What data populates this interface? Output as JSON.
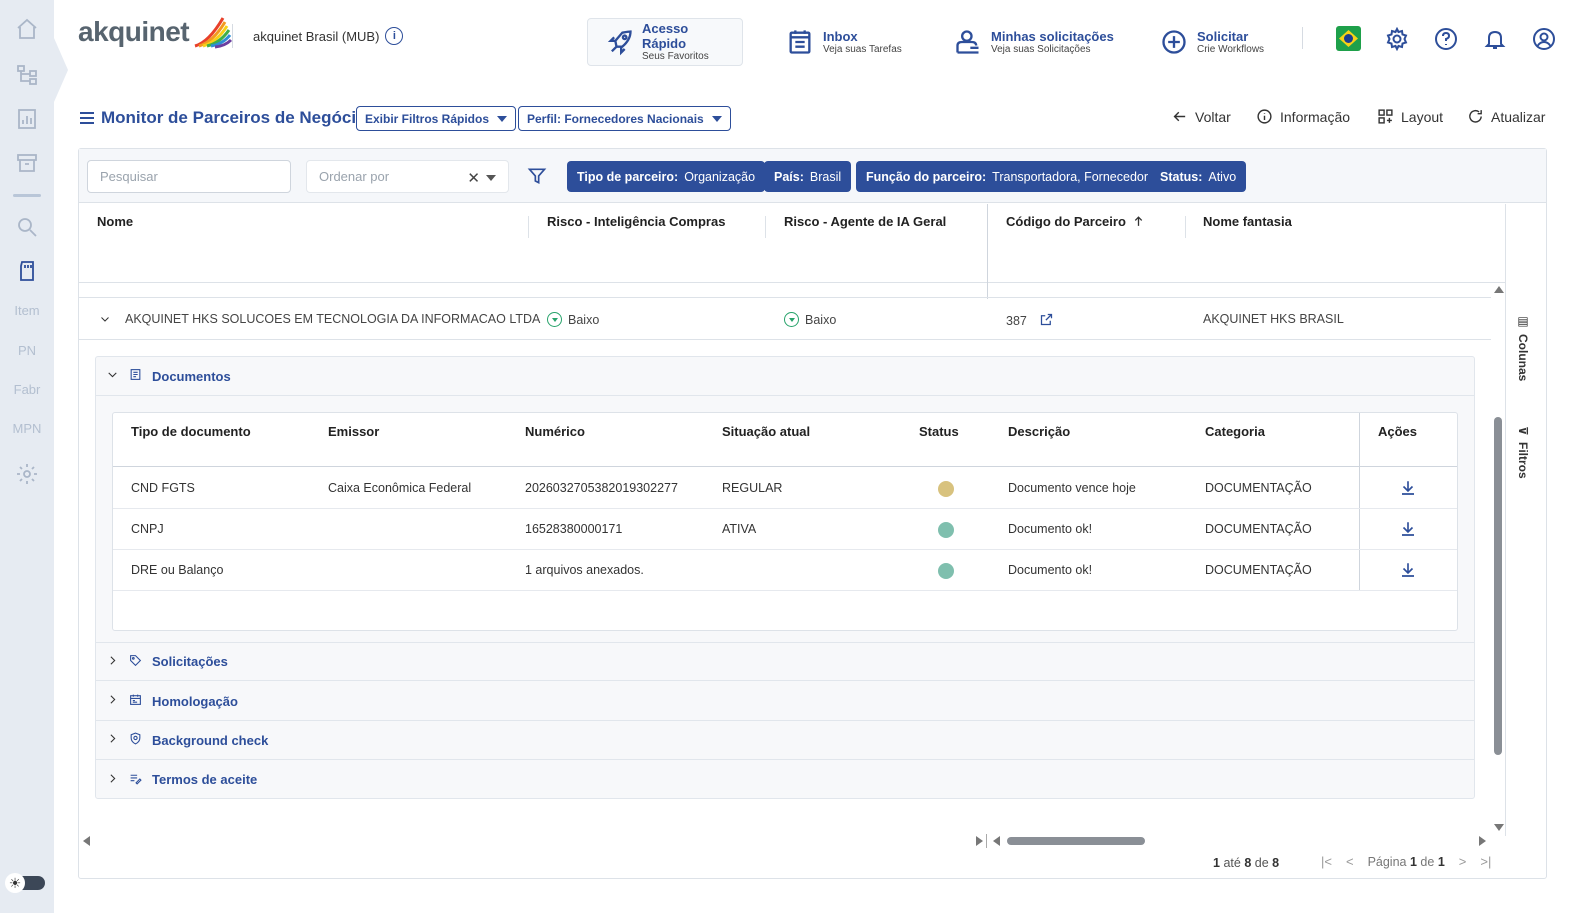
{
  "sidebar": {
    "items": [
      {
        "name": "home-icon"
      },
      {
        "name": "hierarchy-icon"
      },
      {
        "name": "report-icon"
      },
      {
        "name": "archive-icon"
      },
      {
        "name": "search-icon"
      },
      {
        "name": "sd-card-icon"
      }
    ],
    "text_items": [
      "Item",
      "PN",
      "Fabr",
      "MPN"
    ]
  },
  "header": {
    "logo_text": "akquinet",
    "company": "akquinet Brasil (MUB)",
    "actions": [
      {
        "title": "Acesso Rápido",
        "subtitle": "Seus Favoritos"
      },
      {
        "title": "Inbox",
        "subtitle": "Veja suas Tarefas"
      },
      {
        "title": "Minhas solicitações",
        "subtitle": "Veja suas Solicitações"
      },
      {
        "title": "Solicitar",
        "subtitle": "Crie Workflows"
      }
    ]
  },
  "toolbar": {
    "title": "Monitor de Parceiros de Negócio",
    "quick_filters_label": "Exibir Filtros Rápidos",
    "profile_label": "Perfil: Fornecedores Nacionais",
    "back_label": "Voltar",
    "info_label": "Informação",
    "layout_label": "Layout",
    "refresh_label": "Atualizar"
  },
  "filters": {
    "search_placeholder": "Pesquisar",
    "order_placeholder": "Ordenar por",
    "chips": [
      {
        "key": "Tipo de parceiro:",
        "value": "Organização"
      },
      {
        "key": "País:",
        "value": "Brasil"
      },
      {
        "key": "Função do parceiro:",
        "value": "Transportadora, Fornecedor"
      },
      {
        "key": "Status:",
        "value": "Ativo"
      }
    ]
  },
  "columns": {
    "nome": "Nome",
    "risco_compras": "Risco - Inteligência Compras",
    "risco_ia": "Risco - Agente de IA Geral",
    "codigo": "Código do Parceiro",
    "fantasia": "Nome fantasia"
  },
  "side_panel": {
    "columns_label": "Colunas",
    "filters_label": "Filtros"
  },
  "row": {
    "nome": "AKQUINET HKS SOLUCOES EM TECNOLOGIA DA INFORMACAO LTDA",
    "risco_compras": "Baixo",
    "risco_ia": "Baixo",
    "codigo": "387",
    "fantasia": "AKQUINET HKS BRASIL"
  },
  "detail": {
    "sections": [
      "Documentos",
      "Solicitações",
      "Homologação",
      "Background check",
      "Termos de aceite"
    ],
    "doc_columns": {
      "tipo": "Tipo de documento",
      "emissor": "Emissor",
      "numerico": "Numérico",
      "situacao": "Situação atual",
      "status": "Status",
      "descricao": "Descrição",
      "categoria": "Categoria",
      "acoes": "Ações"
    },
    "docs": [
      {
        "tipo": "CND FGTS",
        "emissor": "Caixa Econômica Federal",
        "numerico": "2026032705382019302277",
        "situacao": "REGULAR",
        "status_color": "#d8c27e",
        "descricao": "Documento vence hoje",
        "categoria": "DOCUMENTAÇÃO"
      },
      {
        "tipo": "CNPJ",
        "emissor": "",
        "numerico": "16528380000171",
        "situacao": "ATIVA",
        "status_color": "#7fbfae",
        "descricao": "Documento ok!",
        "categoria": "DOCUMENTAÇÃO"
      },
      {
        "tipo": "DRE ou Balanço",
        "emissor": "",
        "numerico": "1 arquivos anexados.",
        "situacao": "",
        "status_color": "#7fbfae",
        "descricao": "Documento ok!",
        "categoria": "DOCUMENTAÇÃO"
      }
    ]
  },
  "pager": {
    "from": "1",
    "to_word": "até",
    "to": "8",
    "of_word": "de",
    "total": "8",
    "page_word": "Página",
    "page": "1",
    "pages_of": "de",
    "pages": "1"
  }
}
